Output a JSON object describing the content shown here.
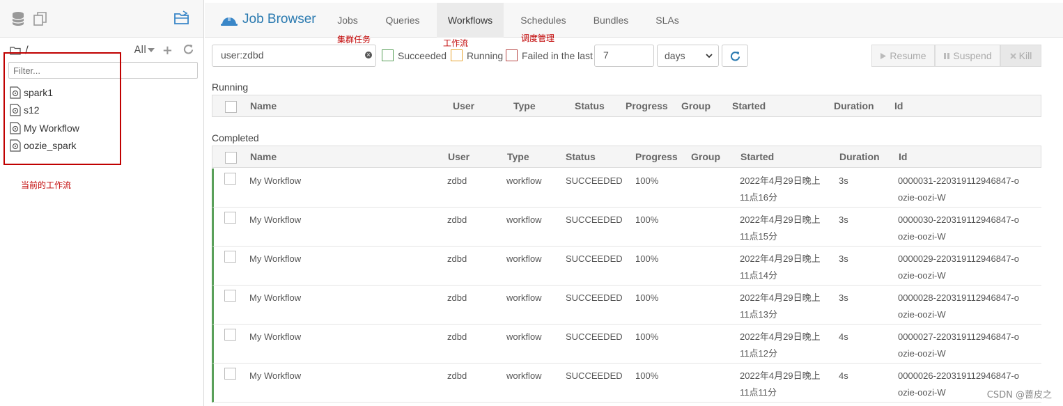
{
  "sidebar": {
    "path": "/",
    "filter_label": "All",
    "filter_placeholder": "Filter...",
    "items": [
      {
        "label": "spark1"
      },
      {
        "label": "s12"
      },
      {
        "label": "My Workflow"
      },
      {
        "label": "oozie_spark"
      }
    ],
    "annotation": "当前的工作流"
  },
  "header": {
    "brand": "Job Browser",
    "tabs": [
      {
        "label": "Jobs"
      },
      {
        "label": "Queries"
      },
      {
        "label": "Workflows",
        "active": true
      },
      {
        "label": "Schedules"
      },
      {
        "label": "Bundles"
      },
      {
        "label": "SLAs"
      }
    ],
    "annotations": {
      "jobs": "集群任务",
      "workflows": "工作流",
      "schedules": "调度管理"
    }
  },
  "toolbar": {
    "search_value": "user:zdbd",
    "succeeded_label": "Succeeded",
    "running_label": "Running",
    "failed_label": "Failed in the last",
    "days_value": "7",
    "unit_value": "days",
    "resume_label": "Resume",
    "suspend_label": "Suspend",
    "kill_label": "Kill",
    "colors": {
      "succeeded": "#5aa05a",
      "running": "#e8a531",
      "failed": "#b94a48"
    }
  },
  "running": {
    "title": "Running",
    "columns": [
      "Name",
      "User",
      "Type",
      "Status",
      "Progress",
      "Group",
      "Started",
      "Duration",
      "Id"
    ]
  },
  "completed": {
    "title": "Completed",
    "columns": [
      "Name",
      "User",
      "Type",
      "Status",
      "Progress",
      "Group",
      "Started",
      "Duration",
      "Id"
    ],
    "rows": [
      {
        "name": "My Workflow",
        "user": "zdbd",
        "type": "workflow",
        "status": "SUCCEEDED",
        "progress": "100%",
        "group": "",
        "started": "2022年4月29日晚上11点16分",
        "duration": "3s",
        "id": "0000031-220319112946847-oozie-oozi-W"
      },
      {
        "name": "My Workflow",
        "user": "zdbd",
        "type": "workflow",
        "status": "SUCCEEDED",
        "progress": "100%",
        "group": "",
        "started": "2022年4月29日晚上11点15分",
        "duration": "3s",
        "id": "0000030-220319112946847-oozie-oozi-W"
      },
      {
        "name": "My Workflow",
        "user": "zdbd",
        "type": "workflow",
        "status": "SUCCEEDED",
        "progress": "100%",
        "group": "",
        "started": "2022年4月29日晚上11点14分",
        "duration": "3s",
        "id": "0000029-220319112946847-oozie-oozi-W"
      },
      {
        "name": "My Workflow",
        "user": "zdbd",
        "type": "workflow",
        "status": "SUCCEEDED",
        "progress": "100%",
        "group": "",
        "started": "2022年4月29日晚上11点13分",
        "duration": "3s",
        "id": "0000028-220319112946847-oozie-oozi-W"
      },
      {
        "name": "My Workflow",
        "user": "zdbd",
        "type": "workflow",
        "status": "SUCCEEDED",
        "progress": "100%",
        "group": "",
        "started": "2022年4月29日晚上11点12分",
        "duration": "4s",
        "id": "0000027-220319112946847-oozie-oozi-W"
      },
      {
        "name": "My Workflow",
        "user": "zdbd",
        "type": "workflow",
        "status": "SUCCEEDED",
        "progress": "100%",
        "group": "",
        "started": "2022年4月29日晚上11点11分",
        "duration": "4s",
        "id": "0000026-220319112946847-oozie-oozi-W"
      }
    ]
  },
  "watermark": "CSDN @蔷皮之"
}
